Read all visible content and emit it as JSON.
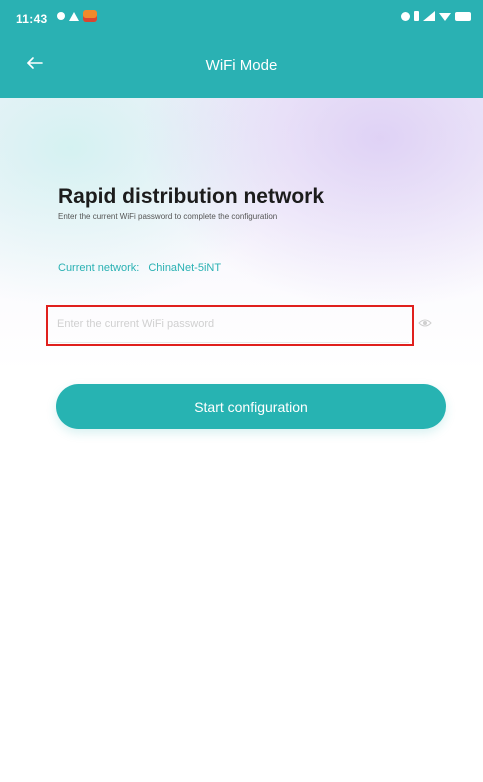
{
  "status_bar": {
    "time": "11:43",
    "left_icons": [
      "notification-dot-icon",
      "triangle-icon",
      "app-badge-icon"
    ],
    "right_icons": [
      "alarm-icon",
      "bluetooth-icon",
      "signal-icon",
      "wifi-icon",
      "battery-icon"
    ]
  },
  "header": {
    "title": "WiFi Mode",
    "back_icon": "arrow-left-icon",
    "background_color": "#2ab1b3"
  },
  "main": {
    "title": "Rapid distribution network",
    "subtitle": "Enter the current WiFi password to complete the configuration",
    "network_label": "Current network:",
    "network_name": "ChinaNet-5iNT",
    "password_input": {
      "value": "",
      "placeholder": "Enter the current WiFi password"
    },
    "password_visibility_icon": "eye-icon",
    "start_button_label": "Start configuration",
    "accent_color": "#27b3b2",
    "highlight_color": "#e0201d"
  }
}
